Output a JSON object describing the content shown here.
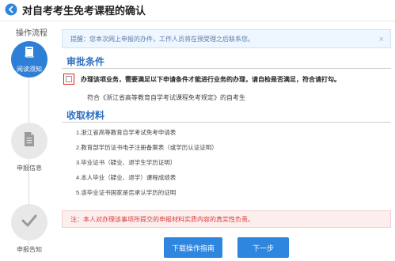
{
  "header": {
    "title": "对自考考生免考课程的确认"
  },
  "steps": {
    "caption": "操作流程",
    "items": [
      {
        "label": "阅读须知",
        "icon": "book-icon",
        "active": true
      },
      {
        "label": "申报信息",
        "icon": "document-icon",
        "active": false
      },
      {
        "label": "申报告知",
        "icon": "check-icon",
        "active": false
      }
    ]
  },
  "tip": {
    "text": "提醒：您本次网上申报的办件，工作人员将在预受理之后联系您。",
    "close": "×"
  },
  "conditions": {
    "title": "审批条件",
    "checkbox_text": "办理该项业务，需要满足以下申请条件才能进行业务的办理，请自检是否满足，符合请打勾。",
    "item": "符合《浙江省高等教育自学考试课程免考规定》的自考生"
  },
  "materials": {
    "title": "收取材料",
    "items": [
      "1.浙江省高等教育自学考试免考申请表",
      "2.教育部学历证书电子注册备案表（或学历认证证明）",
      "3.毕业证书（肄业、退学生学历证明）",
      "4.本人毕业（肄业、退学）课程成绩表",
      "5.该毕业证书国家是否承认学历的证明"
    ]
  },
  "notice": {
    "text": "注：本人对办理该事项所提交的申报材料实质内容的真实性负责。"
  },
  "buttons": {
    "guide": "下载操作指南",
    "next": "下一步"
  },
  "colors": {
    "accent": "#2e7fd6",
    "button": "#2e86de",
    "warning": "#d83a3a"
  }
}
